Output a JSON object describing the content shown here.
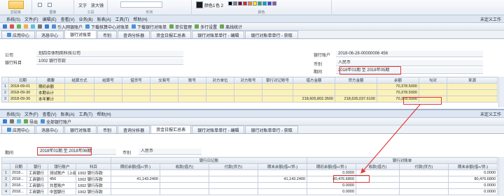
{
  "ribbon": {
    "groups": [
      "剪贴板",
      "图像",
      "工具",
      "形状",
      "颜色"
    ],
    "tools_items": [
      "文字",
      "放大镜"
    ],
    "color1_label": "颜色1",
    "color2_label": "色 2"
  },
  "top": {
    "menu": [
      "系统(S)",
      "文件(F)",
      "编辑(E)",
      "查看(V)",
      "业务(B)",
      "账表(A)",
      "工具(T)",
      "帮助(H)"
    ],
    "right_label": "未定义工作",
    "toolbar": [
      "引入网银账户",
      "下载核算中心对账单",
      "下载银行对账单",
      "单位管理",
      "多行设置",
      "离线统计"
    ],
    "tabs": [
      "应用中心",
      "消息中心",
      "银行对账单",
      "币别",
      "查询分析器",
      "资金日报汇总表",
      "银行对账单单行 - 编辑",
      "银行对账单单行 - 获取"
    ],
    "active_tab": 2,
    "form": {
      "company_label": "公司",
      "company_value": "划四合体制商科技公司",
      "account_label": "银行科目",
      "account_value": "1002 银行存款",
      "bank_acct_label": "银行账户",
      "bank_acct_value": "2018-06-28-00000006 456",
      "currency_label": "币别",
      "currency_value": "人民币",
      "period_label": "期间",
      "period_value": "2018年01期 至 2018年05期"
    },
    "grid": {
      "headers": [
        "",
        "日期",
        "摘要",
        "结算方式",
        "结算号",
        "借贷号",
        "交易号",
        "账号",
        "对方单位",
        "对方账号",
        "银行对记账号",
        "借方金额",
        "贷方金额",
        "余额",
        "勾对",
        "来源"
      ],
      "rows": [
        [
          "1",
          "2018-09-01",
          "期初余额",
          "",
          "",
          "",
          "",
          "",
          "",
          "",
          "",
          "",
          "",
          "70,378.5000",
          "",
          ""
        ],
        [
          "2",
          "2018-09-30",
          "本期合计",
          "",
          "",
          "",
          "",
          "",
          "",
          "",
          "",
          "",
          "",
          "70,378.5000",
          "",
          ""
        ],
        [
          "3",
          "2018-09-30",
          "本年累计",
          "",
          "",
          "",
          "",
          "",
          "",
          "",
          "",
          "218,605,802.3500",
          "218,635,037.6100",
          "70,378.5000",
          "",
          ""
        ]
      ]
    }
  },
  "bottom": {
    "menu": [
      "系统(S)",
      "文件(F)",
      "查看(V)",
      "账表(A)",
      "工具(T)",
      "帮助(H)"
    ],
    "right_label": "未定义工作",
    "toolbar": [
      "导出",
      "全部银行账户"
    ],
    "tabs": [
      "应用中心",
      "消息中心",
      "银行对账单",
      "币别",
      "查询分析器",
      "资金日报汇总表",
      "银行对账单单行 - 编辑",
      "银行对账单单行 - 获取"
    ],
    "active_tab": 5,
    "form": {
      "period_label": "期间",
      "period_value": "2018年01期 至 2018年06期",
      "currency_label": "币别",
      "currency_value": "人民币"
    },
    "grid": {
      "group_headers": {
        "bank_journal": "银行日记账",
        "bank_statement": "银行对账单"
      },
      "headers": [
        "",
        "日期",
        "银行",
        "银行账户",
        "科目",
        "期初余额(借+/贷-)",
        "收款(借方)",
        "付款(贷方)",
        "期末余额(借+/贷-)",
        "期初余额(借+/贷-)",
        "收款(借方)",
        "付款(贷方)",
        "期末余额(借+/贷-)"
      ],
      "rows": [
        [
          "1",
          "2018...",
          "工商银行",
          "测试账户（上级",
          "1002 银行存款",
          "",
          "",
          "",
          "",
          "0.0000",
          "",
          "",
          "0.0000"
        ],
        [
          "2",
          "2018...",
          "工商银行",
          "456",
          "1002 银行存款",
          "41,143.2400",
          "",
          "",
          "41,143.2400",
          "80,476.6800",
          "",
          "",
          "80,476.6800"
        ],
        [
          "3",
          "2018...",
          "工商银行",
          "共管账户",
          "1002 银行存款",
          "",
          "",
          "",
          "",
          "0.0000",
          "",
          "",
          "0.0000"
        ],
        [
          "4",
          "2018...",
          "工商银行",
          "中国银行",
          "1002 银行存款",
          "",
          "",
          "",
          "",
          "0.0000",
          "",
          "",
          "0.0000"
        ]
      ]
    }
  },
  "colors": {
    "highlight_row": "#fcf2b9",
    "annotation_red": "#e0393a",
    "menu_bg": "#dde6f1"
  }
}
